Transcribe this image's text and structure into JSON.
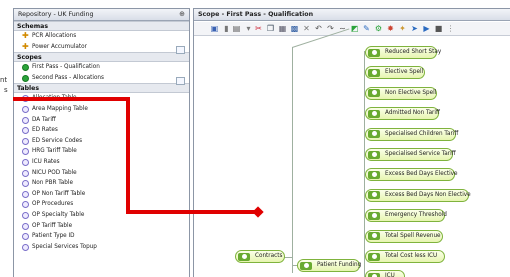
{
  "edge_text": [
    "nt",
    "s"
  ],
  "repository": {
    "title": "Repository - UK Funding",
    "pin_icon": "pin-icon",
    "sections": {
      "schemas": "Schemas",
      "scopes": "Scopes",
      "tables": "Tables"
    },
    "schemas": [
      "PCR Allocations",
      "Power Accumulator"
    ],
    "scopes": [
      "First Pass - Qualification",
      "Second Pass - Allocations"
    ],
    "tables": [
      "Allocation Table",
      "Area Mapping Table",
      "DA Tariff",
      "ED Rates",
      "ED Service Codes",
      "HRG Tariff Table",
      "ICU Rates",
      "NICU POD Table",
      "Non PBR Table",
      "OP Non Tariff Table",
      "OP Procedures",
      "OP Specialty Table",
      "OP Tariff Table",
      "Patient Type ID",
      "Special Services Topup"
    ]
  },
  "scope": {
    "title": "Scope - First Pass - Qualification",
    "nodes": {
      "contracts": "Contracts",
      "patient_funding": "Patient Funding",
      "right": [
        "Reduced Short Stay",
        "Elective Spell",
        "Non Elective Spell",
        "Admitted Non Tariff",
        "Specialised Children Tariff",
        "Specialised Service Tariff",
        "Excess Bed Days Elective",
        "Excess Bed Days Non Elective",
        "Emergency Threshold",
        "Total Spell Revenue",
        "Total Cost less ICU",
        "ICU"
      ]
    }
  },
  "colors": {
    "callout": "#e00000",
    "node_border": "#7fb33d",
    "node_icon": "#69aa30"
  }
}
